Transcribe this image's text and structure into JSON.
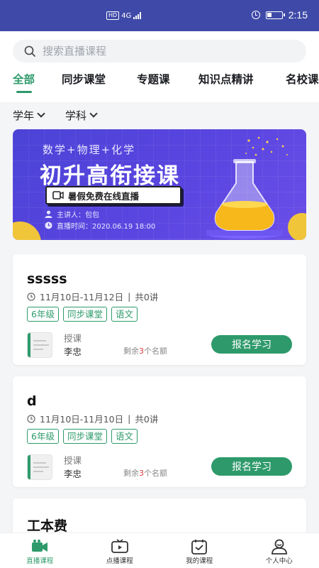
{
  "status_bar": {
    "hd": "HD",
    "network": "4G",
    "time": "2:15"
  },
  "search": {
    "placeholder": "搜索直播课程",
    "icon": "search-icon"
  },
  "tabs": [
    {
      "label": "全部",
      "active": true
    },
    {
      "label": "同步课堂"
    },
    {
      "label": "专题课"
    },
    {
      "label": "知识点精讲"
    },
    {
      "label": "名校课"
    }
  ],
  "filters": [
    {
      "label": "学年"
    },
    {
      "label": "学科"
    }
  ],
  "banner": {
    "subjects": "数学+物理+化学",
    "title": "初升高衔接课",
    "tag": "暑假免费在线直播",
    "lecturer": "主讲人：包包",
    "time": "直播时间：2020.06.19 18:00"
  },
  "courses": [
    {
      "title": "sssss",
      "date_range": "11月10日-11月12日",
      "lessons": "共0讲",
      "tags": [
        "6年级",
        "同步课堂",
        "语文"
      ],
      "teacher_role": "授课",
      "teacher_name": "李忠",
      "remaining_prefix": "剩余",
      "remaining_count": "3",
      "remaining_suffix": "个名额",
      "button": "报名学习"
    },
    {
      "title": "d",
      "date_range": "11月10日-11月10日",
      "lessons": "共0讲",
      "tags": [
        "6年级",
        "同步课堂",
        "语文"
      ],
      "teacher_role": "授课",
      "teacher_name": "李忠",
      "remaining_prefix": "剩余",
      "remaining_count": "3",
      "remaining_suffix": "个名额",
      "button": "报名学习"
    },
    {
      "title": "工本费"
    }
  ],
  "bottom_nav": [
    {
      "label": "直播课程",
      "icon": "live-camera-icon",
      "active": true
    },
    {
      "label": "点播课程",
      "icon": "tv-icon"
    },
    {
      "label": "我的课程",
      "icon": "calendar-icon"
    },
    {
      "label": "个人中心",
      "icon": "user-icon"
    }
  ],
  "colors": {
    "accent": "#2e9a6b",
    "status_bar": "#3f4aa8",
    "banner": "#5a45e0",
    "warning": "#e23c3c"
  }
}
